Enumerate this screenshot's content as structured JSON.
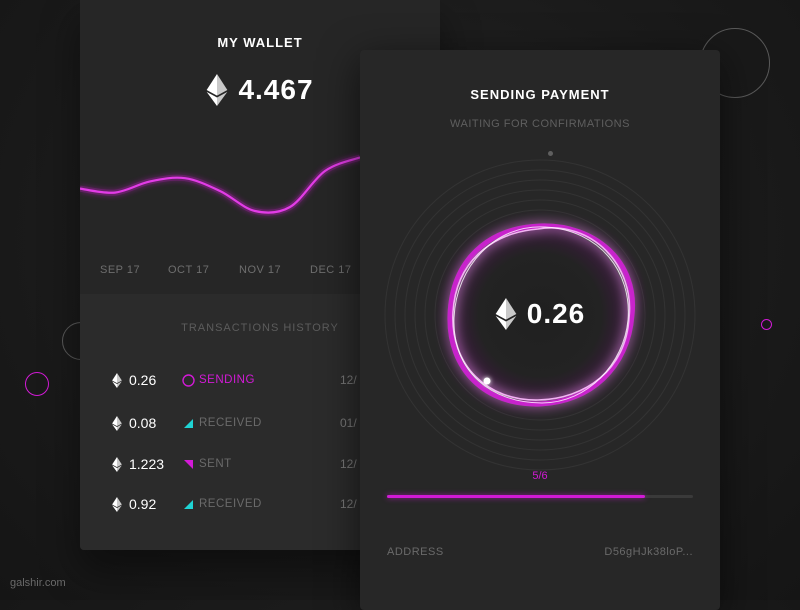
{
  "wallet": {
    "title": "MY WALLET",
    "balance": "4.467",
    "months": [
      "SEP 17",
      "OCT 17",
      "NOV 17",
      "DEC 17"
    ],
    "chart_values": [
      0.33,
      0.28,
      0.42,
      0.46,
      0.3,
      0.05,
      0.1,
      0.55,
      0.72
    ],
    "transactions_title": "TRANSACTIONS HISTORY",
    "transactions": [
      {
        "amount": "0.26",
        "status": "SENDING",
        "kind": "sending",
        "date": "12/"
      },
      {
        "amount": "0.08",
        "status": "RECEIVED",
        "kind": "received",
        "date": "01/"
      },
      {
        "amount": "1.223",
        "status": "SENT",
        "kind": "sent",
        "date": "12/"
      },
      {
        "amount": "0.92",
        "status": "RECEIVED",
        "kind": "received",
        "date": "12/"
      }
    ]
  },
  "payment": {
    "title": "SENDING PAYMENT",
    "subtitle": "WAITING FOR CONFIRMATIONS",
    "amount": "0.26",
    "progress_label": "5/6",
    "progress_fraction": 0.843,
    "address_label": "ADDRESS",
    "address_value": "D56gHJk38loP..."
  },
  "colors": {
    "accent": "#d21ad6",
    "received": "#1fd4d4",
    "background": "#1b1b1b",
    "card": "#262626"
  },
  "icons": {
    "currency": "ethereum-icon",
    "sending": "pending-ring-icon",
    "received": "received-triangle-icon",
    "sent": "sent-triangle-icon"
  },
  "watermark": "galshir.com"
}
